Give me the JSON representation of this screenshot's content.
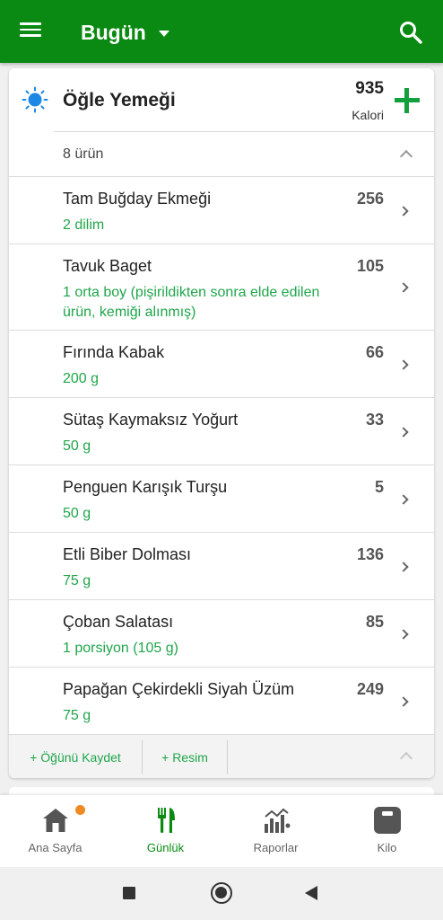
{
  "appbar": {
    "title": "Bugün",
    "menu_icon": "menu-icon",
    "search_icon": "search-icon",
    "color": "#0a8a12"
  },
  "meal": {
    "icon": "sun-icon",
    "title": "Öğle Yemeği",
    "calories": "935",
    "calories_label": "Kalori",
    "item_count": "8 ürün",
    "items": [
      {
        "name": "Tam Buğday Ekmeği",
        "calories": "256",
        "amount": "2  dilim"
      },
      {
        "name": "Tavuk Baget",
        "calories": "105",
        "amount": "1  orta boy (pişirildikten sonra elde edilen ürün, kemiği alınmış)"
      },
      {
        "name": "Fırında Kabak",
        "calories": "66",
        "amount": "200  g"
      },
      {
        "name": "Sütaş Kaymaksız Yoğurt",
        "calories": "33",
        "amount": "50  g"
      },
      {
        "name": "Penguen Karışık Turşu",
        "calories": "5",
        "amount": "50  g"
      },
      {
        "name": "Etli Biber Dolması",
        "calories": "136",
        "amount": "75  g"
      },
      {
        "name": "Çoban Salatası",
        "calories": "85",
        "amount": "1  porsiyon (105 g)"
      },
      {
        "name": "Papağan Çekirdekli Siyah Üzüm",
        "calories": "249",
        "amount": "75  g"
      }
    ],
    "save_meal_label": "+ Öğünü Kaydet",
    "add_photo_label": "+ Resim"
  },
  "bottom_nav": {
    "items": [
      {
        "label": "Ana Sayfa",
        "icon": "home-icon",
        "active": false,
        "badge": true
      },
      {
        "label": "Günlük",
        "icon": "fork-knife-icon",
        "active": true
      },
      {
        "label": "Raporlar",
        "icon": "chart-icon",
        "active": false
      },
      {
        "label": "Kilo",
        "icon": "scale-icon",
        "active": false
      }
    ]
  },
  "colors": {
    "accent_green": "#1fa64a",
    "active_green": "#0a8a12",
    "badge_orange": "#f08a24"
  }
}
